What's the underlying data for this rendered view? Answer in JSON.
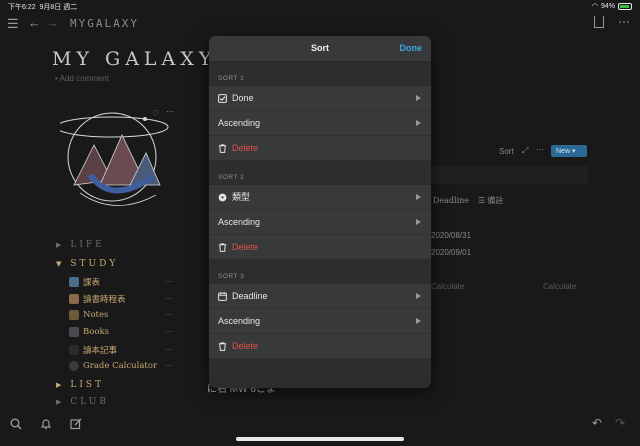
{
  "status": {
    "time": "下午6:22",
    "date": "9月8日 週二",
    "battery": "94%"
  },
  "topbar": {
    "breadcrumb": "MYGALAXY"
  },
  "page": {
    "title": "MY GALAXY",
    "add_comment": "Add comment"
  },
  "nav": {
    "life": "LIFE",
    "study": "STUDY",
    "study_items": [
      "課表",
      "讀書時程表",
      "Notes",
      "Books",
      "讀本記事",
      "Grade Calculator"
    ],
    "list": "LIST",
    "club": "CLUB"
  },
  "background": {
    "sort": "Sort",
    "new": "New",
    "deadline_col": "Deadline",
    "other_col": "備註",
    "date1": "2020/08/31",
    "date2": "2020/09/01",
    "calculate1": "Calculate",
    "calculate2": "Calculate",
    "footer_text": "に右 MW 6こま"
  },
  "sort_sheet": {
    "title": "Sort",
    "done": "Done",
    "sections": [
      {
        "label": "SORT 1",
        "property": "Done",
        "order": "Ascending",
        "delete": "Delete",
        "icon": "checkbox-icon"
      },
      {
        "label": "SORT 2",
        "property": "類型",
        "order": "Ascending",
        "delete": "Delete",
        "icon": "select-icon"
      },
      {
        "label": "SORT 3",
        "property": "Deadline",
        "order": "Ascending",
        "delete": "Delete",
        "icon": "calendar-icon"
      }
    ]
  },
  "colors": {
    "accent": "#3fa6df",
    "delete": "#e2514a",
    "nav_gold": "#c8a974"
  }
}
